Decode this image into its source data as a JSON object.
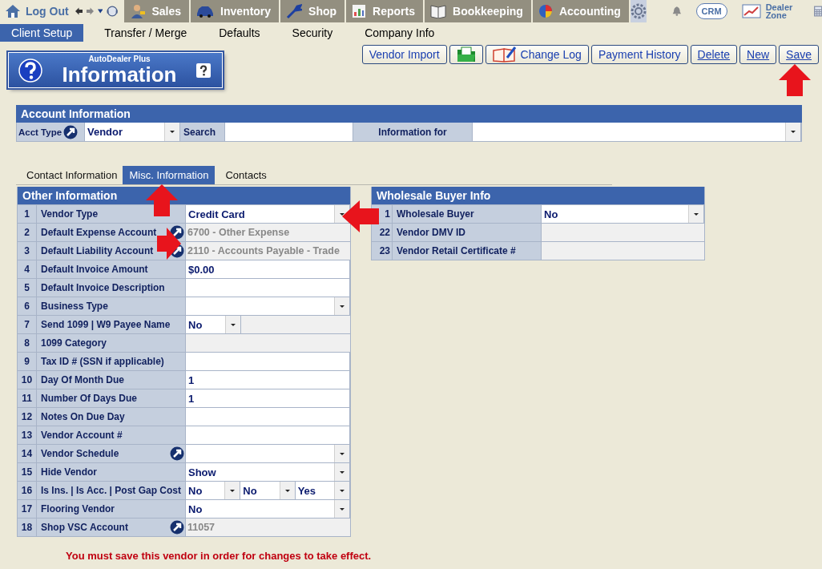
{
  "nav": {
    "logout": "Log Out",
    "modules": [
      {
        "label": "Sales"
      },
      {
        "label": "Inventory"
      },
      {
        "label": "Shop"
      },
      {
        "label": "Reports"
      },
      {
        "label": "Bookkeeping"
      },
      {
        "label": "Accounting"
      }
    ],
    "crm": "CRM",
    "dealer_zone": "Dealer Zone"
  },
  "subtabs": [
    {
      "label": "Client Setup",
      "selected": true
    },
    {
      "label": "Transfer / Merge",
      "selected": false
    },
    {
      "label": "Defaults",
      "selected": false
    },
    {
      "label": "Security",
      "selected": false
    },
    {
      "label": "Company Info",
      "selected": false
    }
  ],
  "banner": {
    "brand": "AutoDealer Plus",
    "title": "Information"
  },
  "toolbar": [
    {
      "kind": "text",
      "label": "Vendor Import"
    },
    {
      "kind": "folder"
    },
    {
      "kind": "log",
      "label": "Change Log"
    },
    {
      "kind": "text",
      "label": "Payment History"
    },
    {
      "kind": "text",
      "label": "Delete",
      "underline": true
    },
    {
      "kind": "text",
      "label": "New",
      "underline": true
    },
    {
      "kind": "text",
      "label": "Save",
      "underline": true
    }
  ],
  "account": {
    "title": "Account Information",
    "acct_type_label": "Acct Type",
    "acct_type": "Vendor",
    "search_label": "Search",
    "info_for_label": "Information for"
  },
  "tabs": [
    {
      "label": "Contact Information",
      "selected": false
    },
    {
      "label": "Misc. Information",
      "selected": true
    },
    {
      "label": "Contacts",
      "selected": false
    }
  ],
  "other": {
    "title": "Other Information",
    "rows": [
      {
        "num": "1",
        "label": "Vendor Type",
        "kind": "select",
        "value": "Credit Card"
      },
      {
        "num": "2",
        "label": "Default Expense Account",
        "kind": "readonly",
        "value": "6700 - Other Expense",
        "link": true
      },
      {
        "num": "3",
        "label": "Default Liability Account",
        "kind": "readonly",
        "value": "2110 - Accounts Payable - Trade",
        "link": true
      },
      {
        "num": "4",
        "label": "Default Invoice Amount",
        "kind": "input",
        "value": "$0.00"
      },
      {
        "num": "5",
        "label": "Default Invoice Description",
        "kind": "input"
      },
      {
        "num": "6",
        "label": "Business Type",
        "kind": "select"
      },
      {
        "num": "7",
        "label": "Send 1099 | W9 Payee Name",
        "kind": "select_readonly",
        "values": [
          "No"
        ]
      },
      {
        "num": "8",
        "label": "1099 Category",
        "kind": "readonly"
      },
      {
        "num": "9",
        "label": "Tax ID # (SSN if applicable)",
        "kind": "input"
      },
      {
        "num": "10",
        "label": "Day Of Month Due",
        "kind": "input",
        "value": "1"
      },
      {
        "num": "11",
        "label": "Number Of Days Due",
        "kind": "input",
        "value": "1"
      },
      {
        "num": "12",
        "label": "Notes On Due Day",
        "kind": "input"
      },
      {
        "num": "13",
        "label": "Vendor Account #",
        "kind": "input"
      },
      {
        "num": "14",
        "label": "Vendor Schedule",
        "kind": "select",
        "link": true
      },
      {
        "num": "15",
        "label": "Hide Vendor",
        "kind": "select",
        "value": "Show"
      },
      {
        "num": "16",
        "label": "Is Ins. | Is Acc. | Post Gap Cost",
        "kind": "multi",
        "values": [
          "No",
          "No",
          "Yes"
        ]
      },
      {
        "num": "17",
        "label": "Flooring Vendor",
        "kind": "select",
        "value": "No"
      },
      {
        "num": "18",
        "label": "Shop VSC Account",
        "kind": "readonly",
        "value": "11057",
        "link": true
      }
    ]
  },
  "wholesale": {
    "title": "Wholesale Buyer Info",
    "rows": [
      {
        "num": "1",
        "label": "Wholesale Buyer",
        "kind": "select",
        "value": "No"
      },
      {
        "num": "22",
        "label": "Vendor DMV ID",
        "kind": "readonly"
      },
      {
        "num": "23",
        "label": "Vendor Retail Certificate #",
        "kind": "readonly"
      }
    ]
  },
  "notice": "You must save this vendor in order for changes to take effect."
}
